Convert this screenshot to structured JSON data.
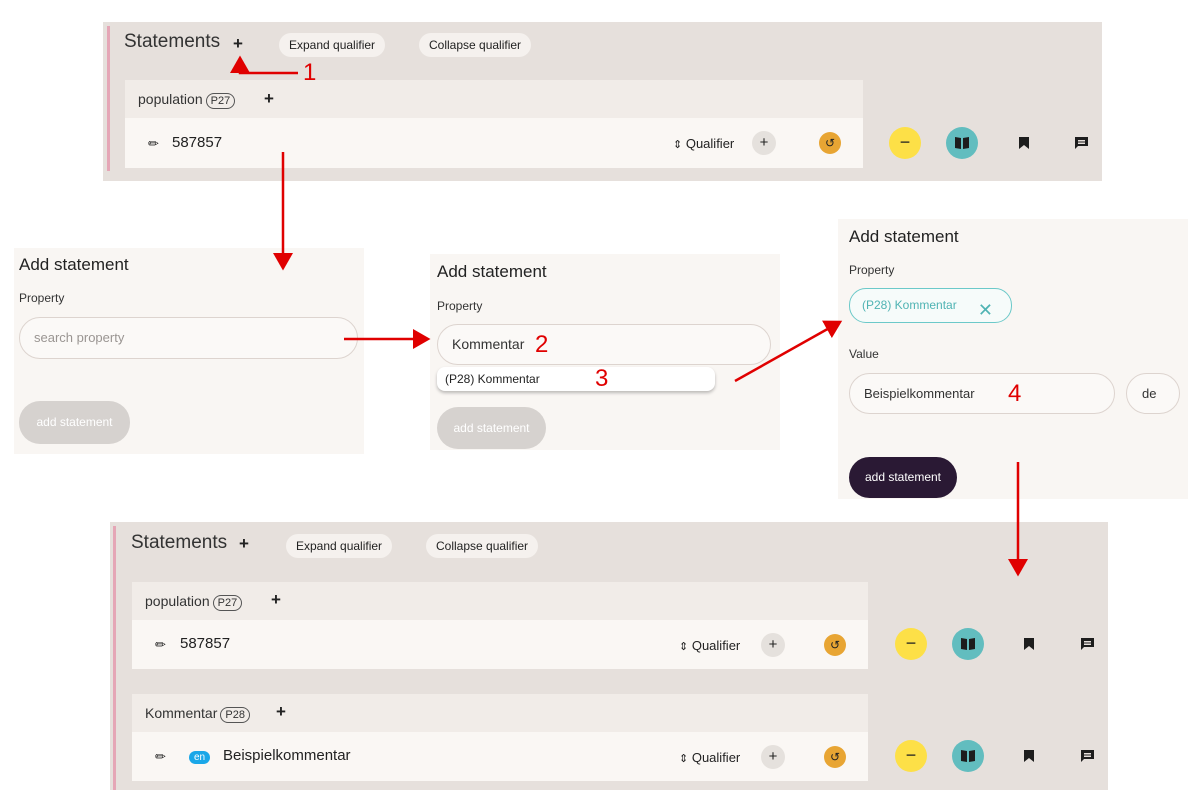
{
  "top_panel": {
    "title": "Statements",
    "add_icon": "+",
    "expand_label": "Expand qualifier",
    "collapse_label": "Collapse qualifier",
    "statements": [
      {
        "property": "population",
        "pid": "P27",
        "value": "587857",
        "qualifier_label": "Qualifier"
      }
    ]
  },
  "step1_panel": {
    "title": "Add statement",
    "property_label": "Property",
    "search_placeholder": "search property",
    "button_label": "add statement"
  },
  "step2_panel": {
    "title": "Add statement",
    "property_label": "Property",
    "search_value": "Kommentar",
    "suggestion": "(P28) Kommentar",
    "button_label": "add statement"
  },
  "step3_panel": {
    "title": "Add statement",
    "property_label": "Property",
    "selected_property": "(P28) Kommentar",
    "value_label": "Value",
    "value_input": "Beispielkommentar",
    "language": "de",
    "button_label": "add statement"
  },
  "bottom_panel": {
    "title": "Statements",
    "add_icon": "+",
    "expand_label": "Expand qualifier",
    "collapse_label": "Collapse qualifier",
    "statements": [
      {
        "property": "population",
        "pid": "P27",
        "value": "587857",
        "qualifier_label": "Qualifier"
      },
      {
        "property": "Kommentar",
        "pid": "P28",
        "lang": "en",
        "value": "Beispielkommentar",
        "qualifier_label": "Qualifier"
      }
    ]
  },
  "annotations": [
    "1",
    "2",
    "3",
    "4"
  ],
  "colors": {
    "panel_bg": "#e6e0dc",
    "accent_bar": "#e5a6b6",
    "history": "#e8a533",
    "minus": "#fde047",
    "book": "#62bdbf",
    "dark_button": "#2a1934",
    "arrow": "#e00000",
    "lang_tag": "#1aa7e8"
  },
  "icons": [
    "plus-icon",
    "pencil-icon",
    "sort-icon",
    "history-icon",
    "minus-icon",
    "book-icon",
    "bookmark-icon",
    "comment-icon",
    "close-icon",
    "arrow-icon"
  ]
}
